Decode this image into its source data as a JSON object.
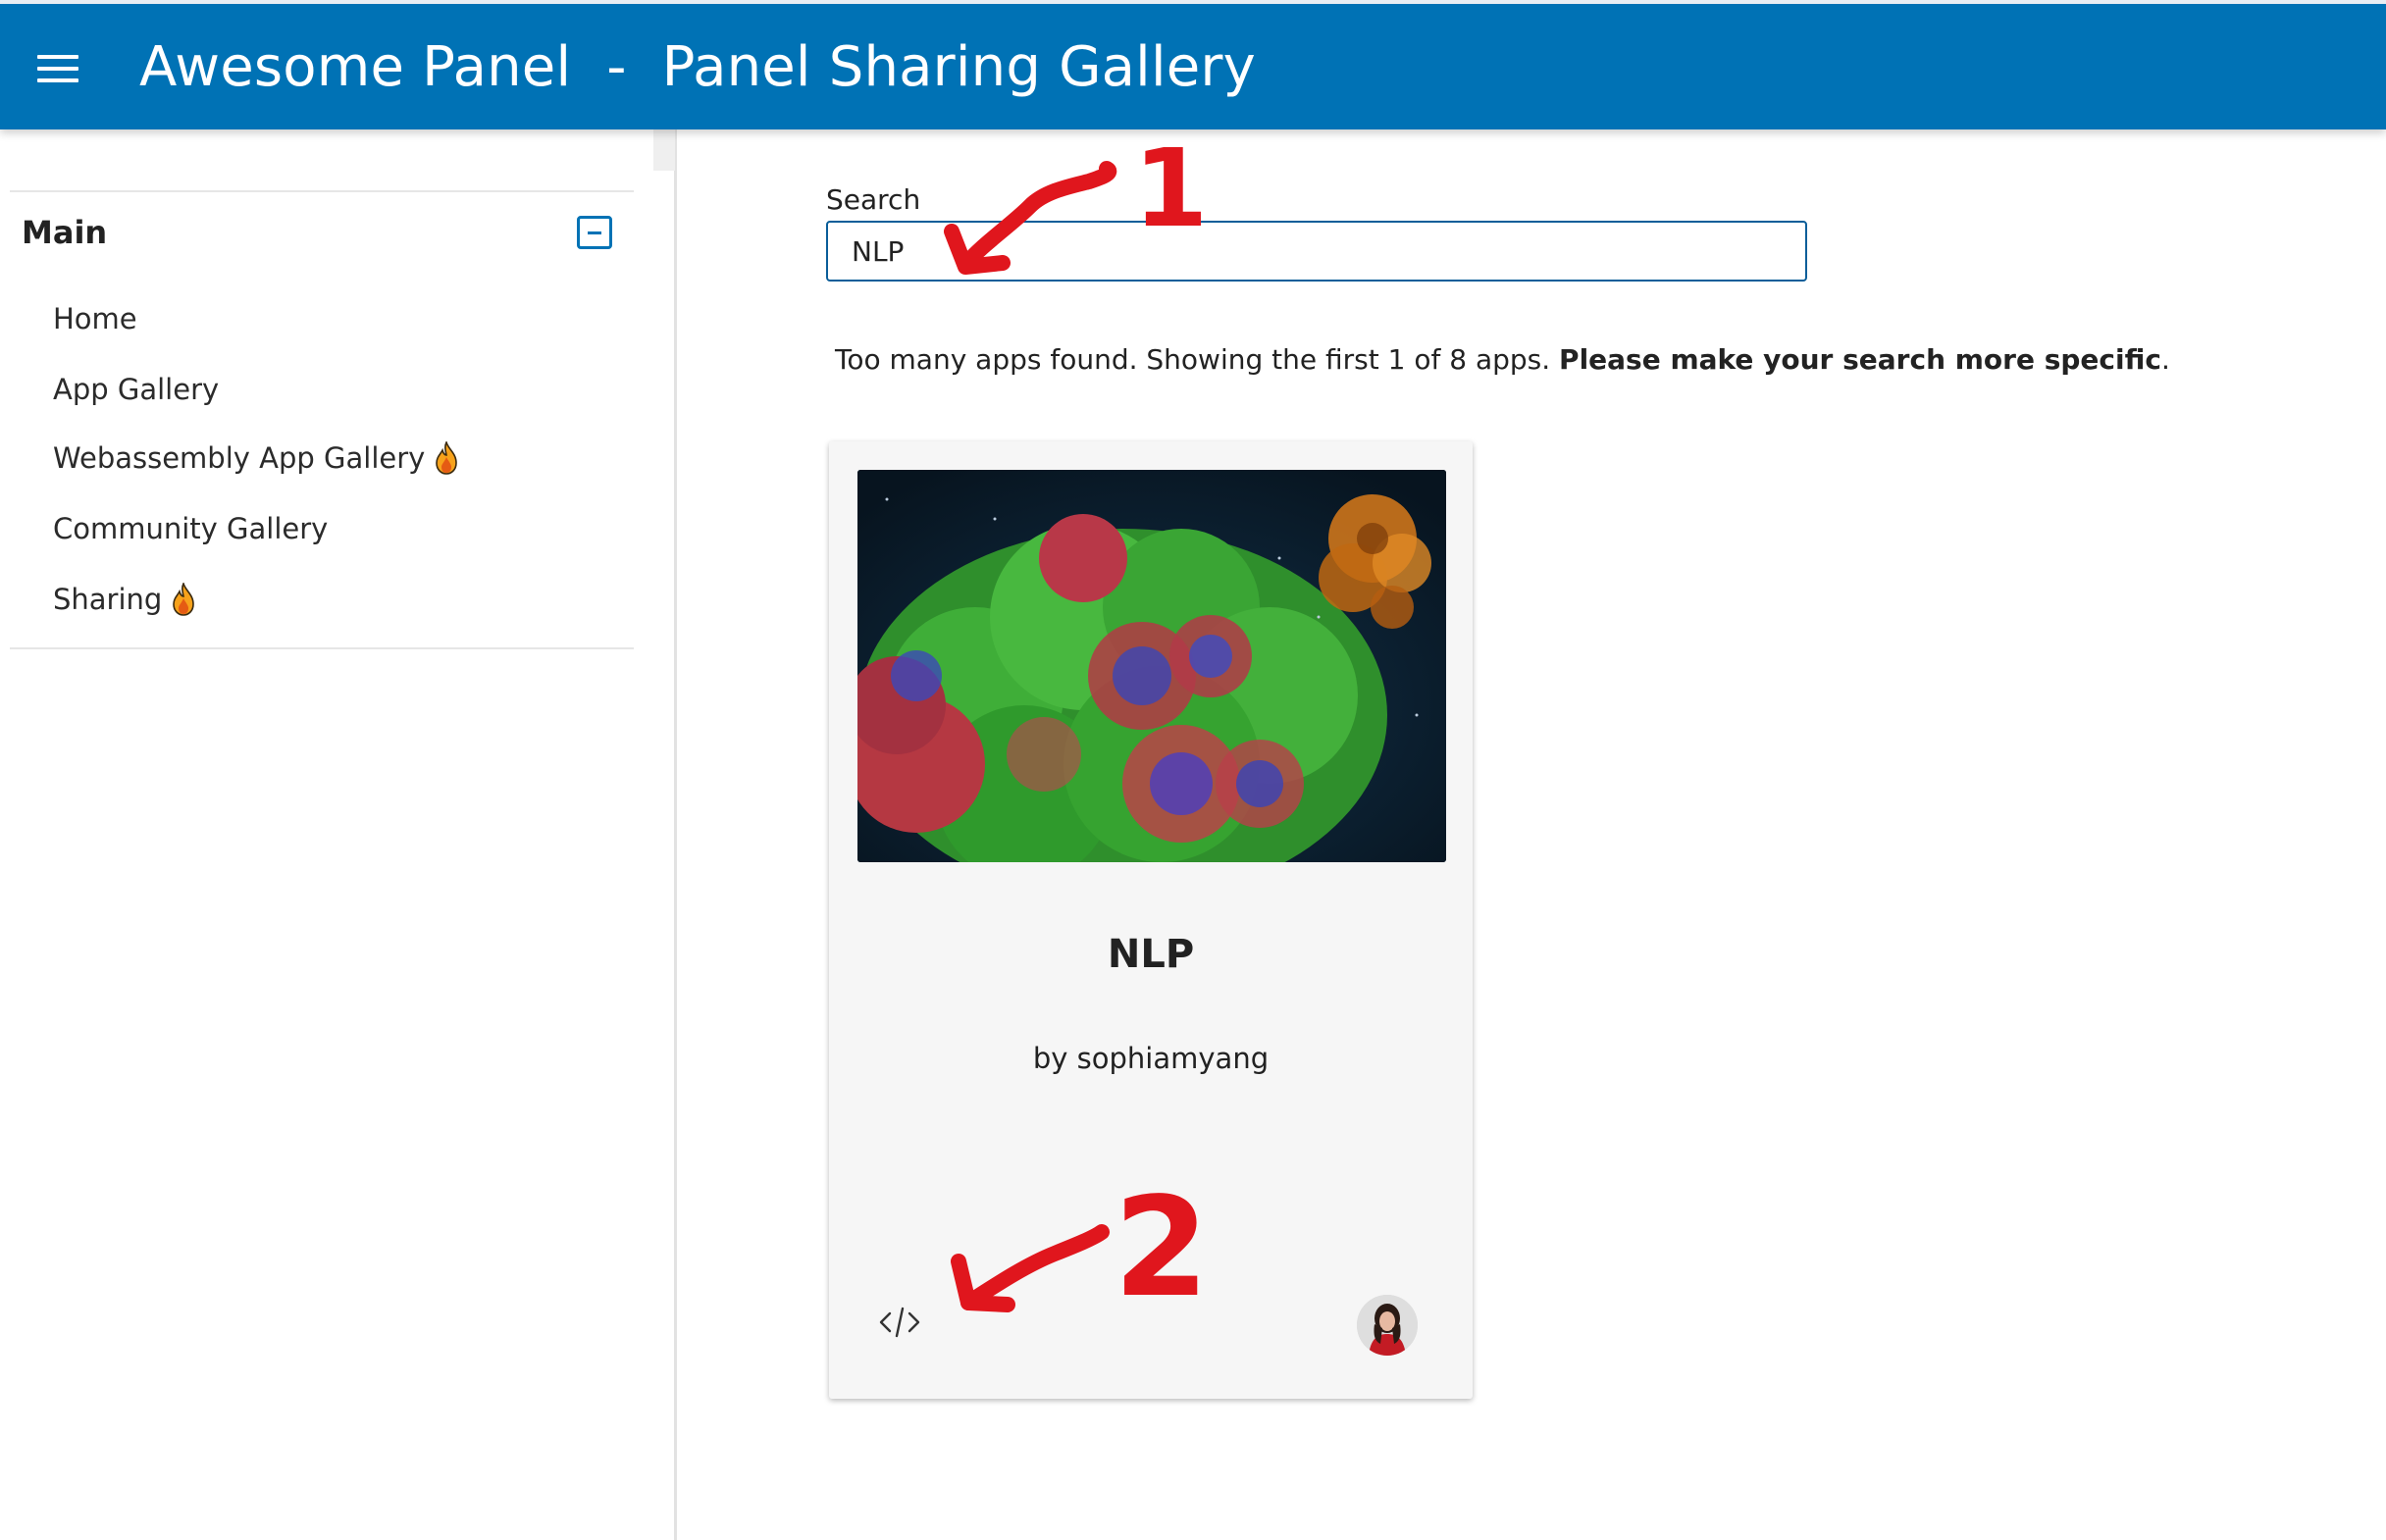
{
  "header": {
    "title": "Awesome Panel  -  Panel Sharing Gallery",
    "background_color": "#0072b5"
  },
  "sidebar": {
    "section_title": "Main",
    "items": [
      {
        "label": "Home",
        "icon": null
      },
      {
        "label": "App Gallery",
        "icon": null
      },
      {
        "label": "Webassembly App Gallery",
        "icon": "fire-icon"
      },
      {
        "label": "Community Gallery",
        "icon": null
      },
      {
        "label": "Sharing",
        "icon": "fire-icon"
      }
    ]
  },
  "search": {
    "label": "Search",
    "value": "NLP"
  },
  "message": {
    "text": "Too many apps found. Showing the first 1 of 8 apps. ",
    "emphasis": "Please make your search more specific",
    "suffix": "."
  },
  "card": {
    "title": "NLP",
    "author": "by sophiamyang",
    "code_icon": "code-icon",
    "avatar_icon": "avatar"
  },
  "annotations": {
    "marker_1": "1",
    "marker_2": "2",
    "color": "#e0161d"
  }
}
